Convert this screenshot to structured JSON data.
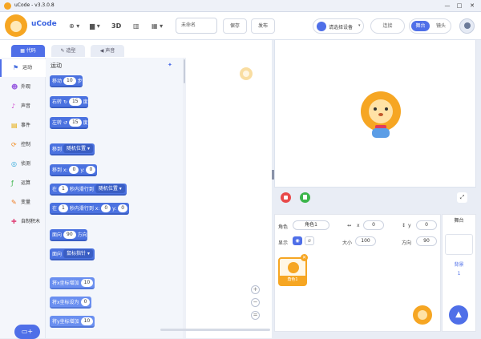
{
  "window": {
    "title": "uCode - v3.3.0.8",
    "min": "—",
    "max": "□",
    "close": "✕"
  },
  "toolbar": {
    "app_name": "uCode",
    "view_3d": "3D",
    "project_name": "未命名",
    "save_label": "保存",
    "publish_label": "发布",
    "device_label": "请选择设备",
    "connect_label": "连接",
    "mode_stage": "舞台",
    "mode_lens": "镜头"
  },
  "tabs": [
    {
      "label": "代码"
    },
    {
      "label": "造型"
    },
    {
      "label": "声音"
    }
  ],
  "categories": [
    {
      "label": "运动",
      "icon": "run-icon"
    },
    {
      "label": "外观",
      "icon": "look-icon"
    },
    {
      "label": "声音",
      "icon": "sound-icon"
    },
    {
      "label": "事件",
      "icon": "event-icon"
    },
    {
      "label": "控制",
      "icon": "control-icon"
    },
    {
      "label": "侦测",
      "icon": "sense-icon"
    },
    {
      "label": "运算",
      "icon": "operator-icon"
    },
    {
      "label": "变量",
      "icon": "variable-icon"
    },
    {
      "label": "自制积木",
      "icon": "myblock-icon"
    }
  ],
  "palette": {
    "section_title": "运动",
    "blocks": [
      {
        "pre": "移动",
        "v1": "10",
        "mid": "步"
      },
      {
        "pre": "右转",
        "v1": "15",
        "mid": "度"
      },
      {
        "pre": "左转",
        "v1": "15",
        "mid": "度"
      },
      {
        "pre": "移到",
        "dd": "随机位置"
      },
      {
        "pre": "移到 x:",
        "v1": "0",
        "mid": "y:",
        "v2": "0"
      },
      {
        "pre": "在",
        "v1": "1",
        "mid": "秒内滑行到",
        "dd": "随机位置"
      },
      {
        "pre": "在",
        "v1": "1",
        "mid": "秒内滑行到 x:",
        "v2": "0",
        "post": "y:",
        "v3": "0"
      },
      {
        "pre": "面向",
        "v1": "90",
        "mid": "方向"
      },
      {
        "pre": "面向",
        "dd": "鼠标指针"
      },
      {
        "pre": "将x坐标增加",
        "v1": "10"
      },
      {
        "pre": "将x坐标设为",
        "v1": "0"
      },
      {
        "pre": "将y坐标增加",
        "v1": "10"
      }
    ]
  },
  "workspace": {
    "zoom_in": "+",
    "zoom_out": "−",
    "reset": "="
  },
  "sprite": {
    "label_sprite": "角色",
    "name": "角色1",
    "label_x": "x",
    "x": "0",
    "label_y": "y",
    "y": "0",
    "label_show": "显示",
    "label_size": "大小",
    "size": "100",
    "label_dir": "方向",
    "direction": "90",
    "thumb_name": "角色1"
  },
  "stage_panel": {
    "title": "舞台",
    "backdrop_label": "背景",
    "backdrop_count": "1"
  },
  "colors": {
    "accent": "#4f6fe8",
    "block": "#4b72e0",
    "lion": "#f6a623"
  }
}
